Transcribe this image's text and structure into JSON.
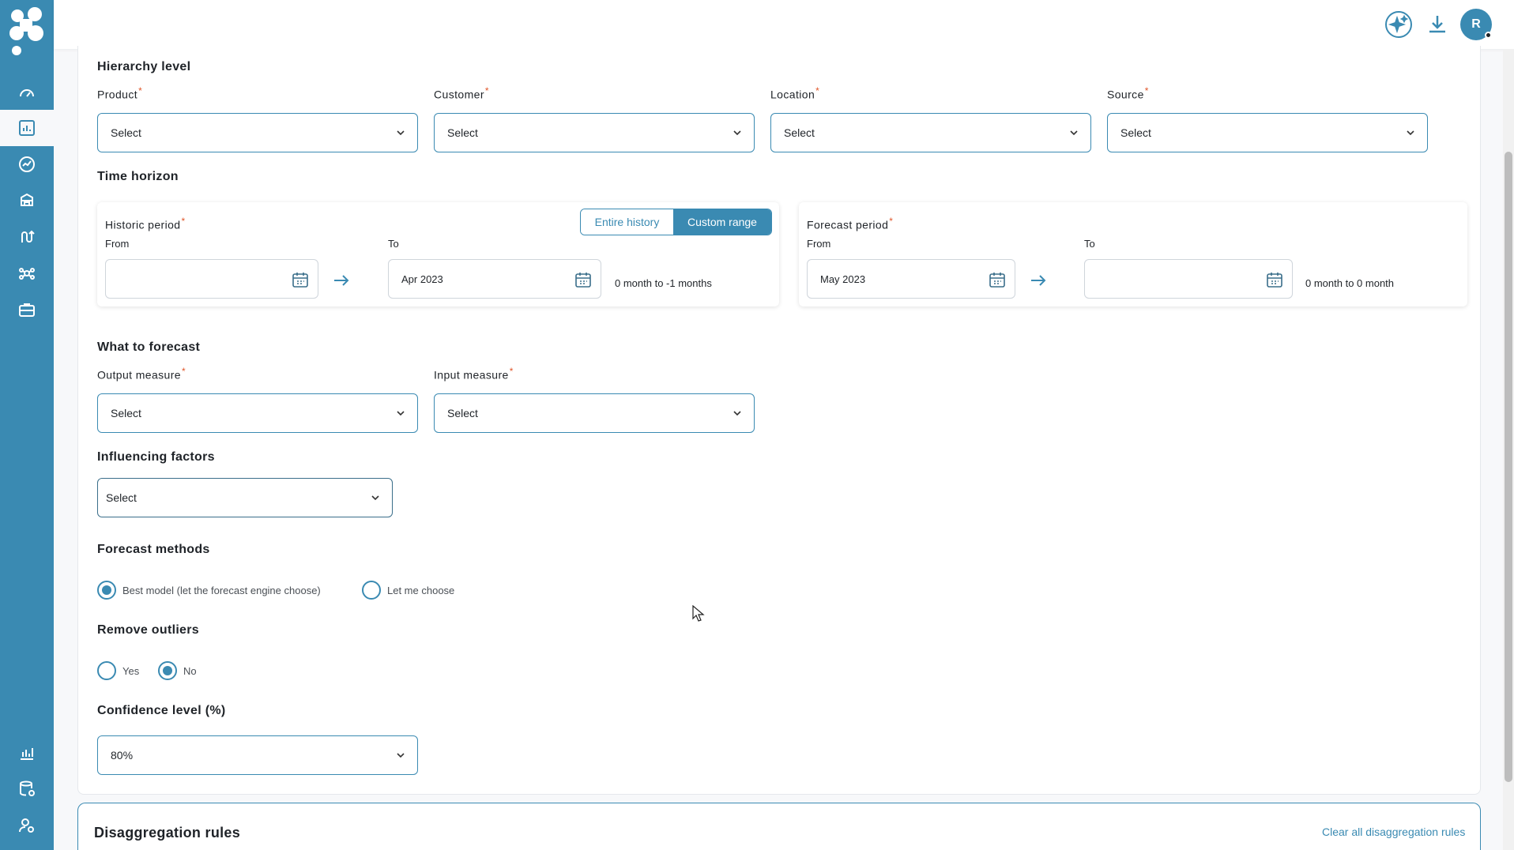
{
  "header": {
    "avatar_initial": "R",
    "icons": [
      "ai-sparkle-icon",
      "download-icon"
    ]
  },
  "sidebar": {
    "items": [
      "dashboard-icon",
      "analytics-icon",
      "trend-icon",
      "inventory-icon",
      "route-icon",
      "network-icon",
      "briefcase-icon",
      "reports-icon",
      "database-settings-icon",
      "user-settings-icon"
    ],
    "active_index": 1
  },
  "hierarchy": {
    "title": "Hierarchy level",
    "fields": [
      {
        "label": "Product",
        "value": "Select"
      },
      {
        "label": "Customer",
        "value": "Select"
      },
      {
        "label": "Location",
        "value": "Select"
      },
      {
        "label": "Source",
        "value": "Select"
      }
    ]
  },
  "time_horizon": {
    "title": "Time horizon",
    "historic": {
      "label": "Historic period",
      "toggle": {
        "entire": "Entire history",
        "custom": "Custom range",
        "selected": "Custom range"
      },
      "from_label": "From",
      "from_value": "",
      "to_label": "To",
      "to_value": "Apr 2023",
      "range_text": "0 month to -1 months"
    },
    "forecast": {
      "label": "Forecast period",
      "from_label": "From",
      "from_value": "May 2023",
      "to_label": "To",
      "to_value": "",
      "range_text": "0 month to 0 month"
    }
  },
  "what_to_forecast": {
    "title": "What to forecast",
    "output_label": "Output measure",
    "output_value": "Select",
    "input_label": "Input measure",
    "input_value": "Select"
  },
  "influencing": {
    "title": "Influencing factors",
    "value": "Select"
  },
  "methods": {
    "title": "Forecast methods",
    "options": [
      "Best model (let the forecast engine choose)",
      "Let me choose"
    ],
    "selected": "Best model (let the forecast engine choose)"
  },
  "outliers": {
    "title": "Remove outliers",
    "options": [
      "Yes",
      "No"
    ],
    "selected": "No"
  },
  "confidence": {
    "title": "Confidence level (%)",
    "value": "80%"
  },
  "disaggregation": {
    "title": "Disaggregation rules",
    "clear_link": "Clear all disaggregation rules"
  },
  "colors": {
    "accent": "#3a8ab2",
    "required": "#e0572b"
  }
}
